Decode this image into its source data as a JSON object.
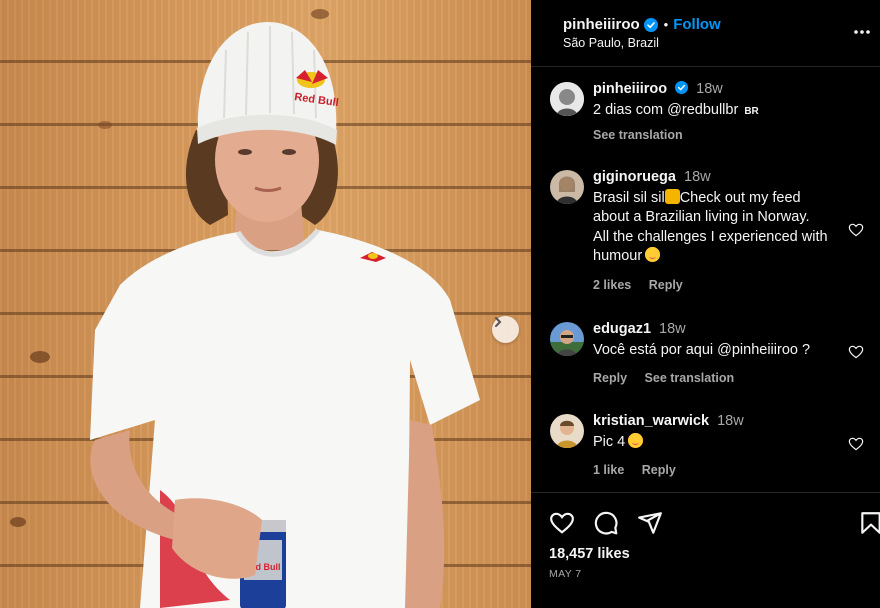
{
  "post": {
    "username": "pinheiiiroo",
    "dot": "•",
    "follow_label": "Follow",
    "location": "São Paulo, Brazil"
  },
  "caption": {
    "username": "pinheiiiroo",
    "time": "18w",
    "text": "2 dias com @redbullbr",
    "tag": "BR",
    "see_translation": "See translation"
  },
  "comments": [
    {
      "username": "giginoruega",
      "time": "18w",
      "text_a": "Brasil sil sil",
      "text_b": "Check out my feed about a Brazilian living in Norway. All the challenges I experienced with humour",
      "likes": "2 likes",
      "reply": "Reply"
    },
    {
      "username": "edugaz1",
      "time": "18w",
      "text": "Você está por aqui @pinheiiiroo ?",
      "reply": "Reply",
      "see_translation": "See translation"
    },
    {
      "username": "kristian_warwick",
      "time": "18w",
      "text": "Pic 4",
      "likes": "1 like",
      "reply": "Reply"
    }
  ],
  "footer": {
    "likes": "18,457 likes",
    "date": "MAY 7"
  },
  "photo": {
    "beanie_text": "Red Bull",
    "can_text": "Red Bull"
  },
  "colors": {
    "background": "#000000",
    "link_blue": "#0095f6",
    "muted_text": "#a8a8a8",
    "divider": "#262626",
    "wood": "#d99b5d",
    "redbull_red": "#d6202e"
  },
  "icons": [
    "verified-badge-icon",
    "more-options-icon",
    "heart-icon",
    "comment-icon",
    "share-icon",
    "bookmark-icon",
    "chevron-right-icon"
  ]
}
